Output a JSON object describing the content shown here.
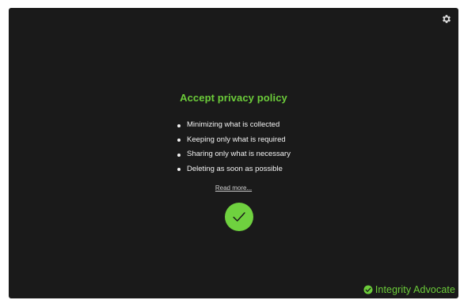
{
  "policy": {
    "title": "Accept privacy policy",
    "points": [
      "Minimizing what is collected",
      "Keeping only what is required",
      "Sharing only what is necessary",
      "Deleting as soon as possible"
    ],
    "read_more": "Read more..."
  },
  "brand": {
    "name": "Integrity Advocate"
  },
  "icons": {
    "settings": "gear-icon",
    "accept": "checkmark-icon",
    "brand_logo": "check-circle-logo-icon"
  },
  "colors": {
    "background": "#1a1a1a",
    "accent": "#6ccc3a",
    "accept_button": "#6fd13f",
    "text": "#f2f2f2"
  }
}
